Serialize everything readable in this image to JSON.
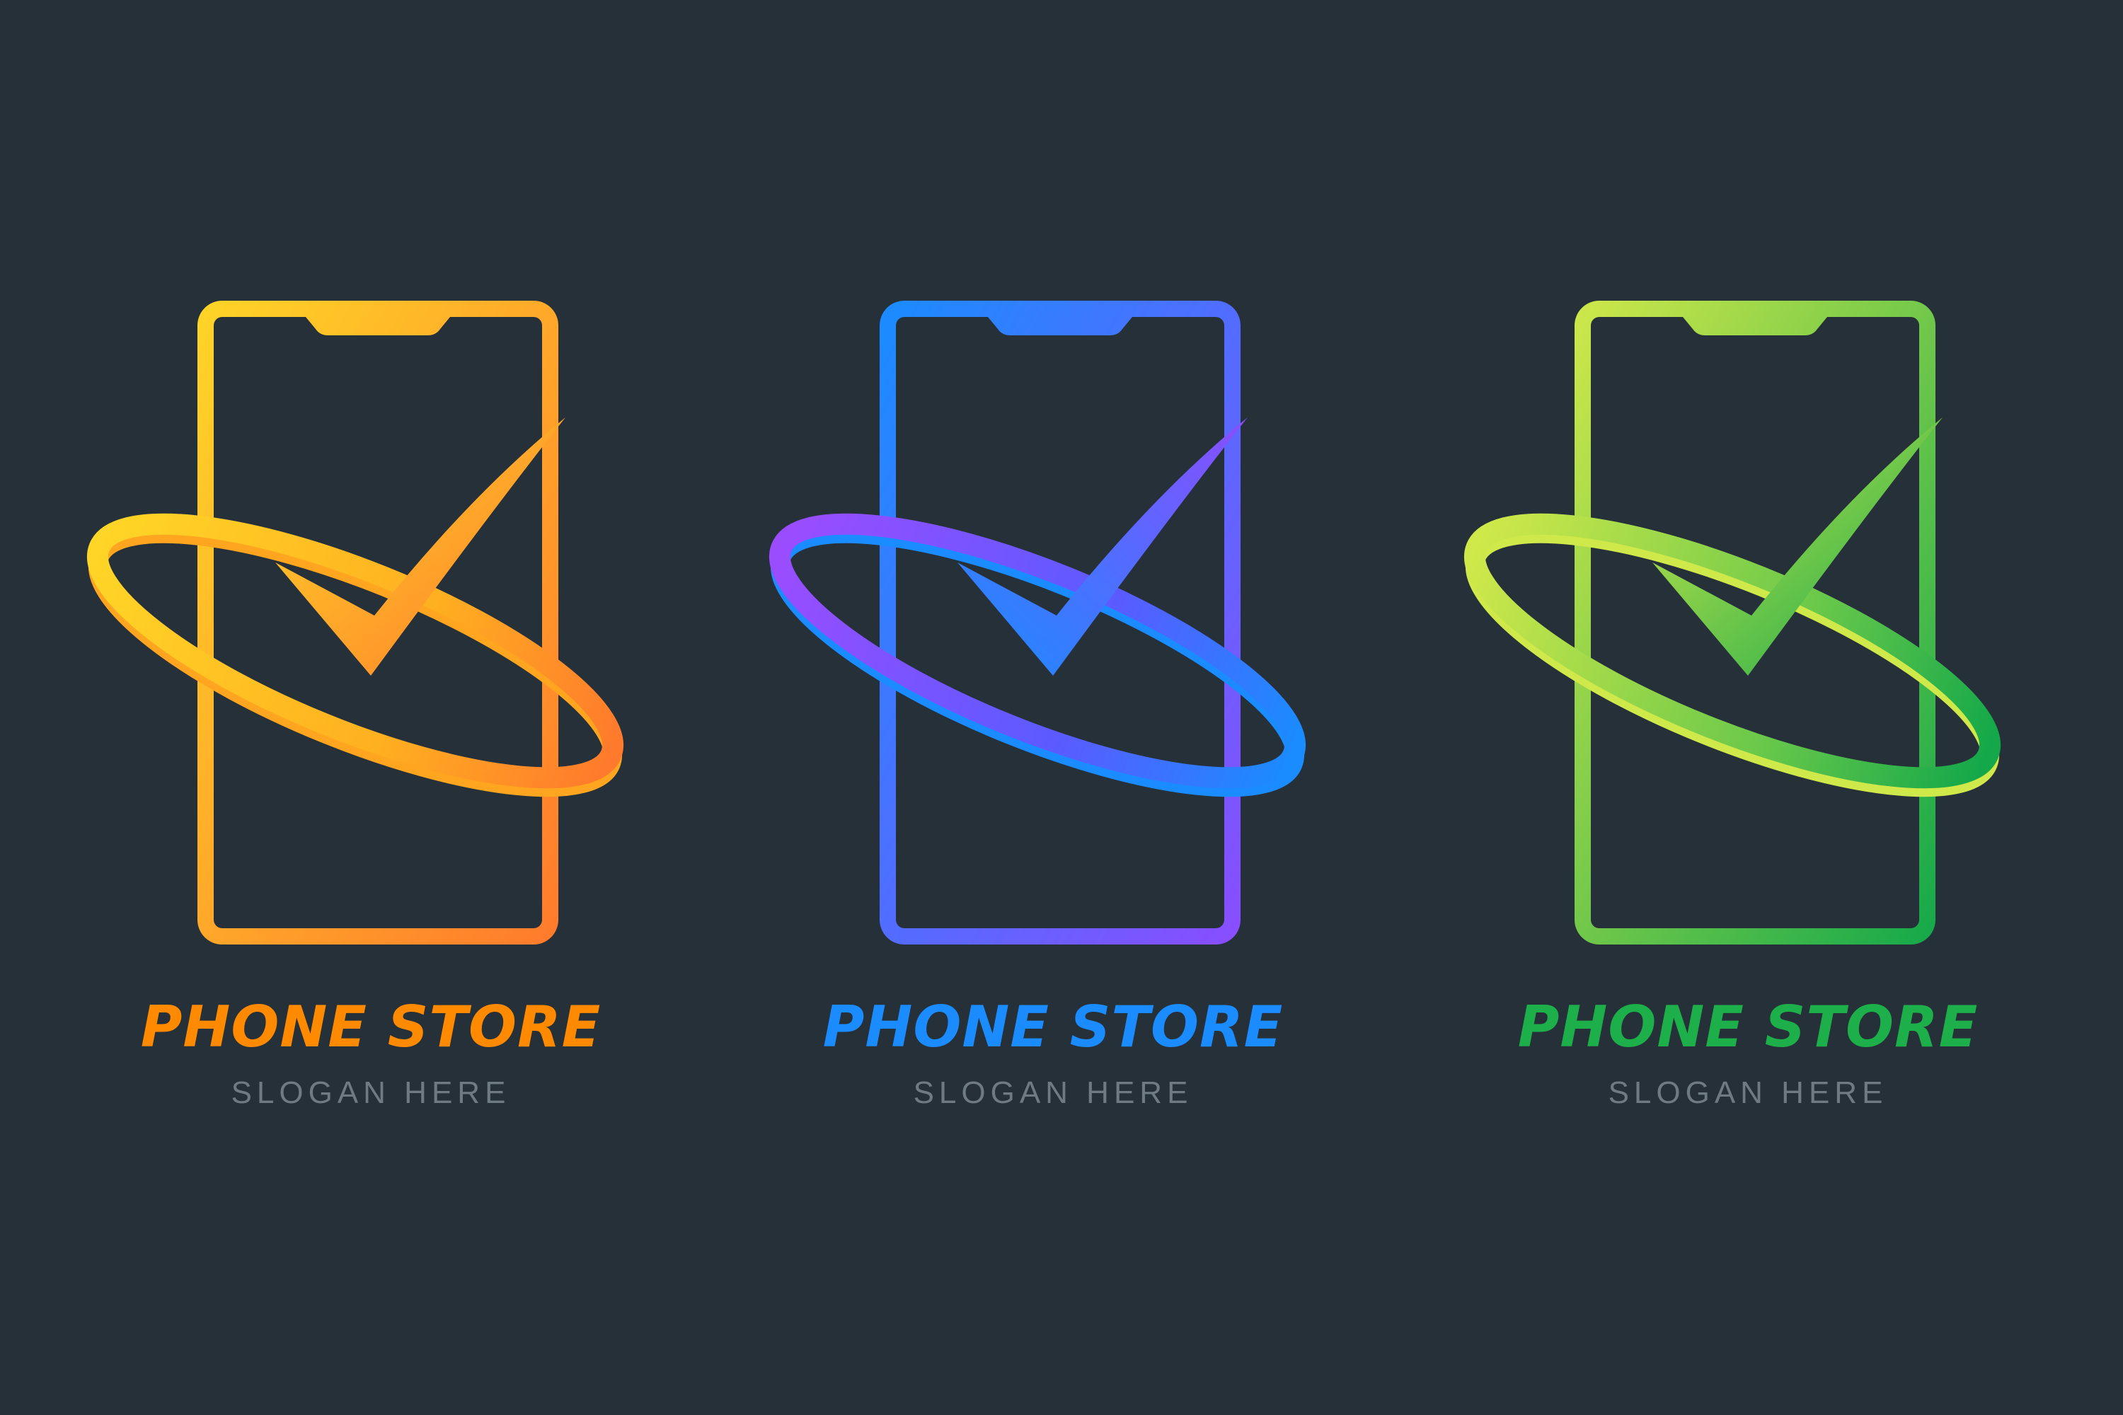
{
  "background_color": "#263038",
  "logos": [
    {
      "name": "PHONE STORE",
      "slogan": "SLOGAN HERE",
      "name_color": "#ff8a00",
      "icons": [
        "smartphone-outline-icon",
        "check-icon",
        "orbit-ring-icon"
      ],
      "gradient": [
        "#ffd527",
        "#ff7a2c"
      ]
    },
    {
      "name": "PHONE STORE",
      "slogan": "SLOGAN HERE",
      "name_color": "#1a8cff",
      "icons": [
        "smartphone-outline-icon",
        "check-icon",
        "orbit-ring-icon"
      ],
      "gradient": [
        "#1a8cff",
        "#8a4dff"
      ]
    },
    {
      "name": "PHONE STORE",
      "slogan": "SLOGAN HERE",
      "name_color": "#1db04a",
      "icons": [
        "smartphone-outline-icon",
        "check-icon",
        "orbit-ring-icon"
      ],
      "gradient": [
        "#cfe84a",
        "#14a84a"
      ]
    }
  ],
  "slogan_color": "#6e7b82"
}
